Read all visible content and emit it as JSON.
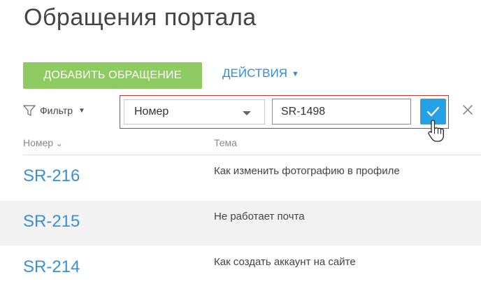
{
  "page": {
    "title": "Обращения портала"
  },
  "toolbar": {
    "add_label": "ДОБАВИТЬ ОБРАЩЕНИЕ",
    "actions_label": "ДЕЙСТВИЯ"
  },
  "filter": {
    "label": "Фильтр",
    "field_value": "Номер",
    "input_value": "SR-1498"
  },
  "table": {
    "columns": [
      "Номер",
      "Тема"
    ],
    "rows": [
      {
        "number": "SR-216",
        "subject": "Как изменить фотографию в профиле"
      },
      {
        "number": "SR-215",
        "subject": "Не работает почта"
      },
      {
        "number": "SR-214",
        "subject": "Как создать аккаунт на сайте"
      }
    ]
  },
  "colors": {
    "accent_green": "#8ecb63",
    "link_blue": "#3a8fd8",
    "apply_blue": "#27a1e6",
    "highlight_red": "#d9302c"
  }
}
